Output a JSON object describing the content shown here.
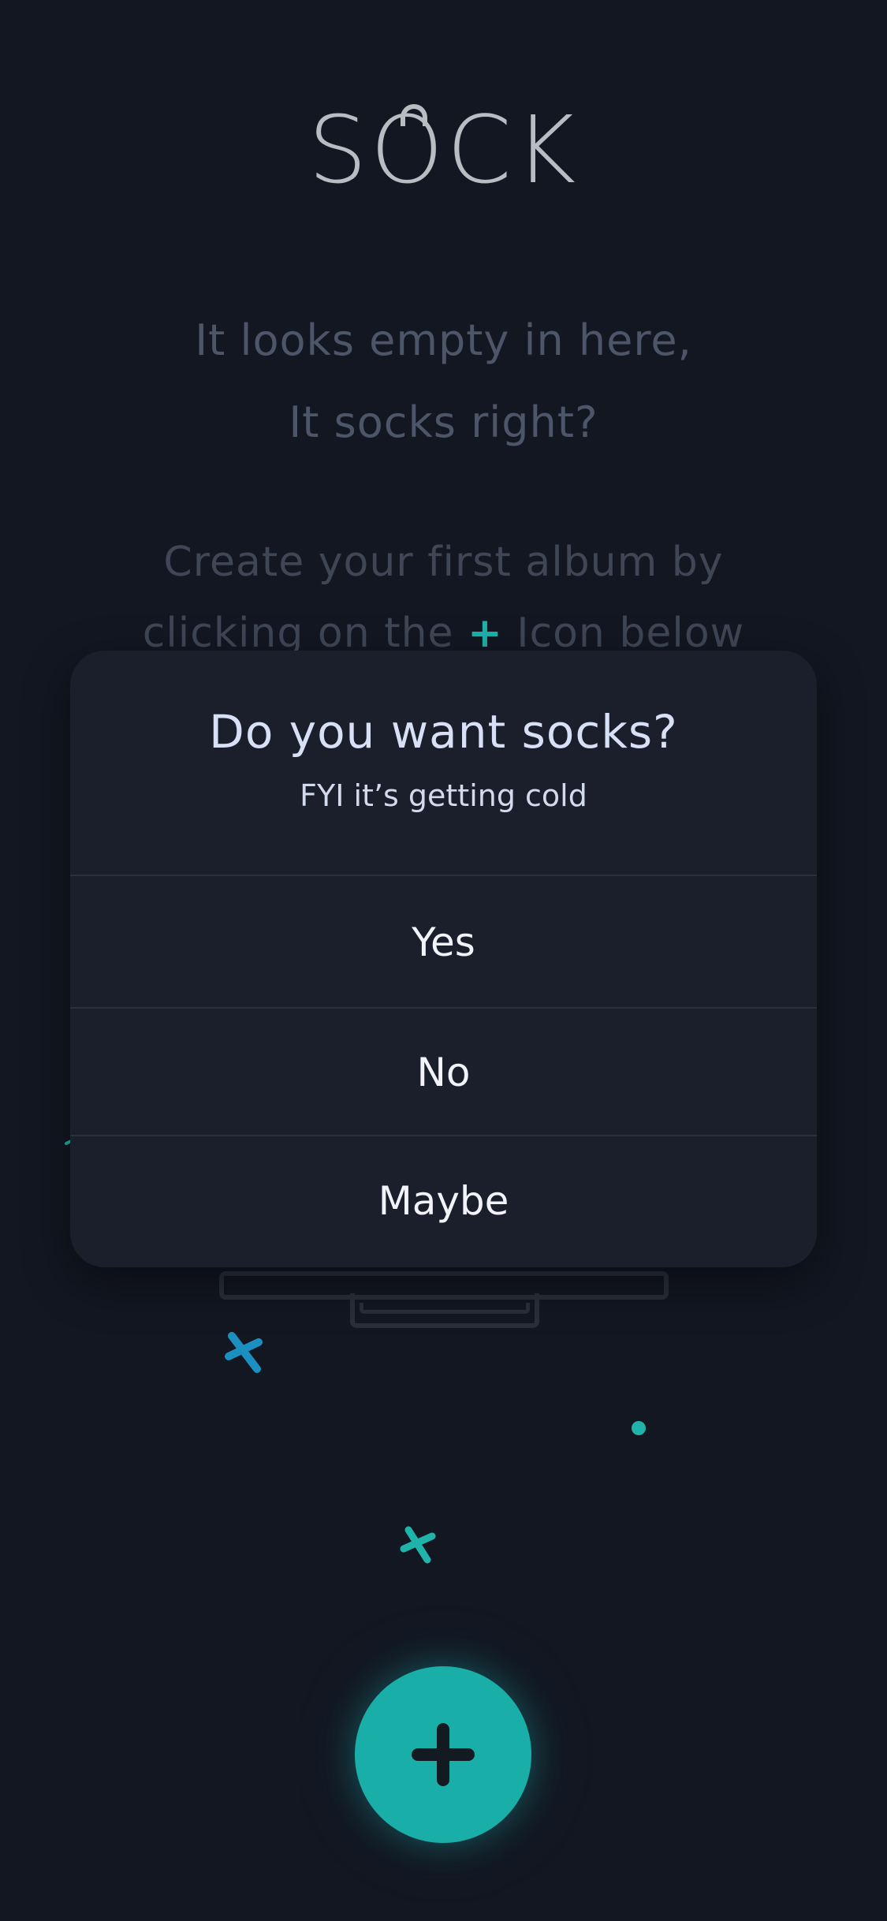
{
  "app": {
    "logo_text": "SOCK"
  },
  "empty_state": {
    "headline_line1": "It looks empty in here,",
    "headline_line2": "It socks right?",
    "instruction_line1": "Create your first album by",
    "instruction_before_icon": "clicking on the",
    "instruction_icon_glyph": "+",
    "instruction_after_icon": "Icon below"
  },
  "dialog": {
    "title": "Do you want socks?",
    "subtitle": "FYI it’s getting cold",
    "options": [
      {
        "label": "Yes"
      },
      {
        "label": "No"
      },
      {
        "label": "Maybe"
      }
    ]
  },
  "fab": {
    "icon": "plus-icon",
    "color": "#1aaea9"
  },
  "colors": {
    "background": "#131722",
    "dialog_background": "#1b1f2b",
    "accent_teal": "#1fb3ac",
    "accent_blue": "#1a8fc0"
  }
}
